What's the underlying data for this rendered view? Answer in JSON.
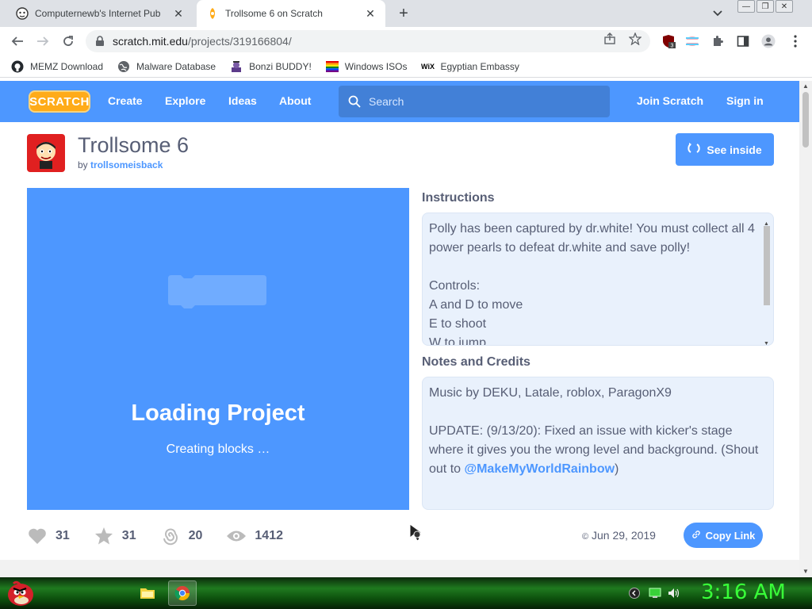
{
  "browser": {
    "tabs": [
      {
        "title": "Computernewb's Internet Pub Hu",
        "active": false
      },
      {
        "title": "Trollsome 6 on Scratch",
        "active": true
      }
    ],
    "url_host": "scratch.mit.edu",
    "url_path": "/projects/319166804/",
    "extension_badge": "3",
    "bookmarks": [
      {
        "label": "MEMZ Download",
        "icon": "github-icon"
      },
      {
        "label": "Malware Database",
        "icon": "globe-icon"
      },
      {
        "label": "Bonzi BUDDY!",
        "icon": "bonzi-icon"
      },
      {
        "label": "Windows ISOs",
        "icon": "windows-flag-icon"
      },
      {
        "label": "Egyptian Embassy",
        "icon": "wix-icon"
      }
    ]
  },
  "scratch_nav": {
    "logo": "SCRATCH",
    "links": [
      "Create",
      "Explore",
      "Ideas",
      "About"
    ],
    "search_placeholder": "Search",
    "join": "Join Scratch",
    "signin": "Sign in"
  },
  "project": {
    "title": "Trollsome 6",
    "by_prefix": "by",
    "author": "trollsomeisback",
    "see_inside": "See inside",
    "loading_title": "Loading Project",
    "loading_sub": "Creating blocks …",
    "instructions_label": "Instructions",
    "instructions": "Polly has been captured by dr.white! You must collect all 4 power pearls to defeat dr.white and save polly!\n\nControls:\nA and D to move\nE to shoot\nW to jump",
    "notes_label": "Notes and Credits",
    "notes_intro": "Music by DEKU, Latale, roblox, ParagonX9\n\nUPDATE: (9/13/20): Fixed an issue with kicker's stage where it gives you the wrong level and background. (Shout out to ",
    "notes_mention": "@MakeMyWorldRainbow",
    "notes_end": ")",
    "loves": "31",
    "favorites": "31",
    "remixes": "20",
    "views": "1412",
    "date": "Jun 29, 2019",
    "copy_link": "Copy Link"
  },
  "taskbar": {
    "clock": "3:16 AM"
  },
  "colors": {
    "scratch_blue": "#4d97ff",
    "text": "#575e75"
  }
}
